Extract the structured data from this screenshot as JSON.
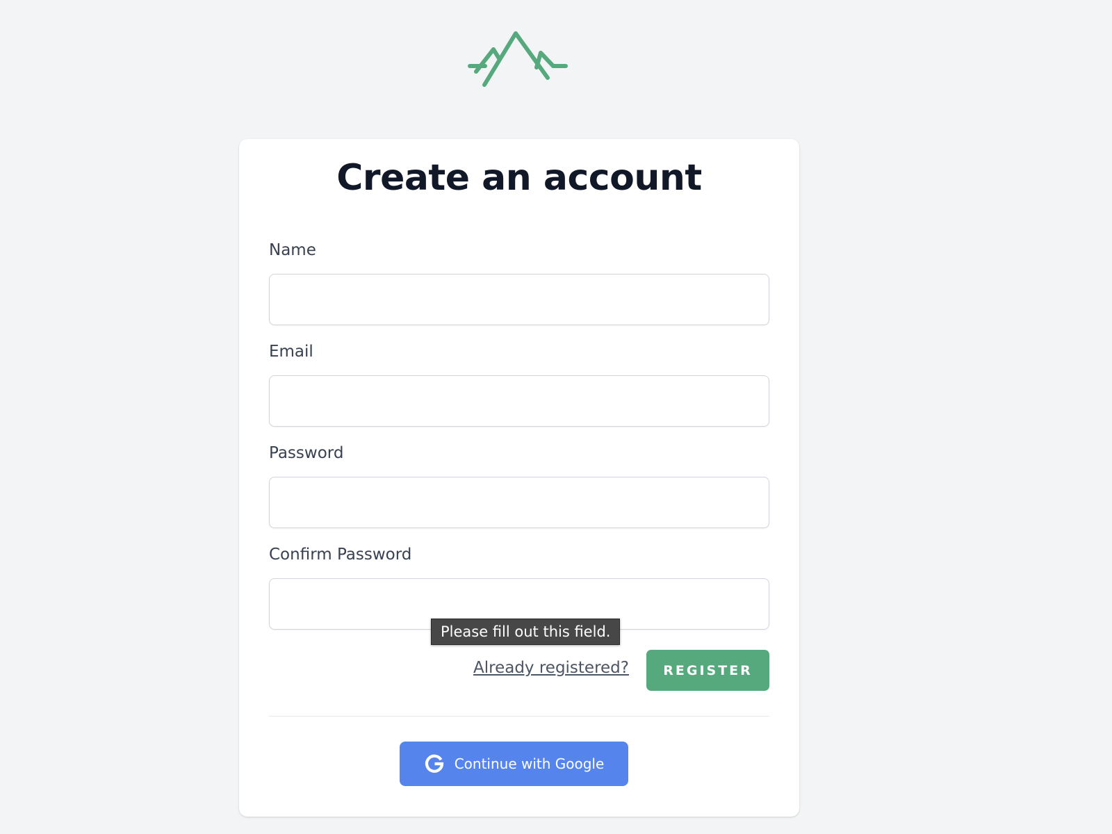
{
  "app": {
    "logo_icon": "mountain-logo-icon",
    "accent_color": "#56a97d"
  },
  "form": {
    "title": "Create an account",
    "fields": [
      {
        "label": "Name",
        "value": "",
        "type": "text"
      },
      {
        "label": "Email",
        "value": "",
        "type": "email"
      },
      {
        "label": "Password",
        "value": "",
        "type": "password"
      },
      {
        "label": "Confirm Password",
        "value": "",
        "type": "password"
      }
    ],
    "validation_tooltip": "Please fill out this field.",
    "login_link": "Already registered?",
    "register_button": "REGISTER",
    "register_color": "#56a97d"
  },
  "oauth": {
    "google_button": "Continue with Google",
    "google_icon": "google-g-icon",
    "google_color": "#5585ec"
  }
}
